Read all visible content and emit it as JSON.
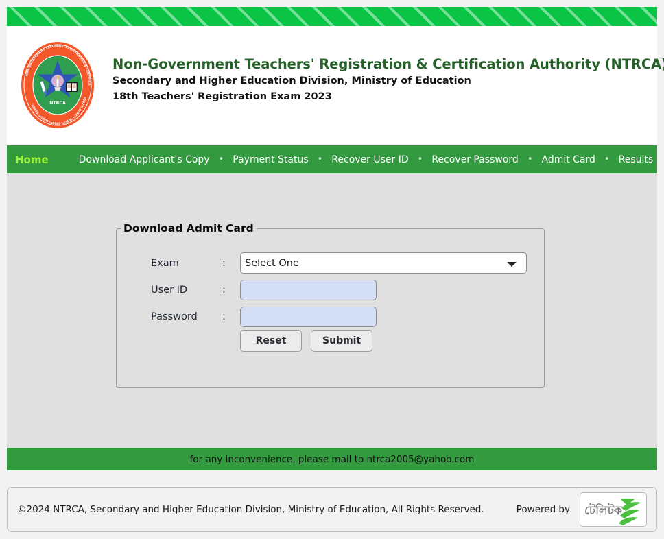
{
  "header": {
    "logo_alt": "ntrca-seal-logo",
    "org_title": "Non-Government Teachers' Registration & Certification Authority (NTRCA)",
    "org_sub_1": "Secondary and Higher Education Division, Ministry of Education",
    "org_sub_2": "18th Teachers' Registration Exam 2023",
    "title_color": "#256029"
  },
  "nav": {
    "home_label": "Home",
    "home_color": "#9cf53a",
    "bar_color": "#349a40",
    "separator": "•",
    "items": [
      {
        "label": "Download Applicant's Copy"
      },
      {
        "label": "Payment Status"
      },
      {
        "label": "Recover User ID"
      },
      {
        "label": "Recover Password"
      },
      {
        "label": "Admit Card"
      },
      {
        "label": "Results"
      }
    ]
  },
  "form": {
    "legend": "Download Admit Card",
    "exam_label": "Exam",
    "user_id_label": "User ID",
    "password_label": "Password",
    "colon": ":",
    "exam_selected": "Select One",
    "exam_options": [
      "Select One"
    ],
    "user_id_value": "",
    "password_value": "",
    "user_id_placeholder": "",
    "password_placeholder": "",
    "reset_label": "Reset",
    "submit_label": "Submit",
    "field_bg": "#d4deF5"
  },
  "notice": {
    "text": "for any inconvenience, please mail to ntrca2005@yahoo.com"
  },
  "footer": {
    "copyright": "©2024 NTRCA, Secondary and Higher Education Division, Ministry of Education, All Rights Reserved.",
    "powered_by": "Powered by",
    "logo_alt": "teletalk-logo",
    "logo_text": "টেলিটক"
  },
  "theme": {
    "banner_green": "#0bc445",
    "nav_green": "#349a40",
    "content_gray": "#e0e0e0",
    "page_gray": "#f2f2f2"
  }
}
